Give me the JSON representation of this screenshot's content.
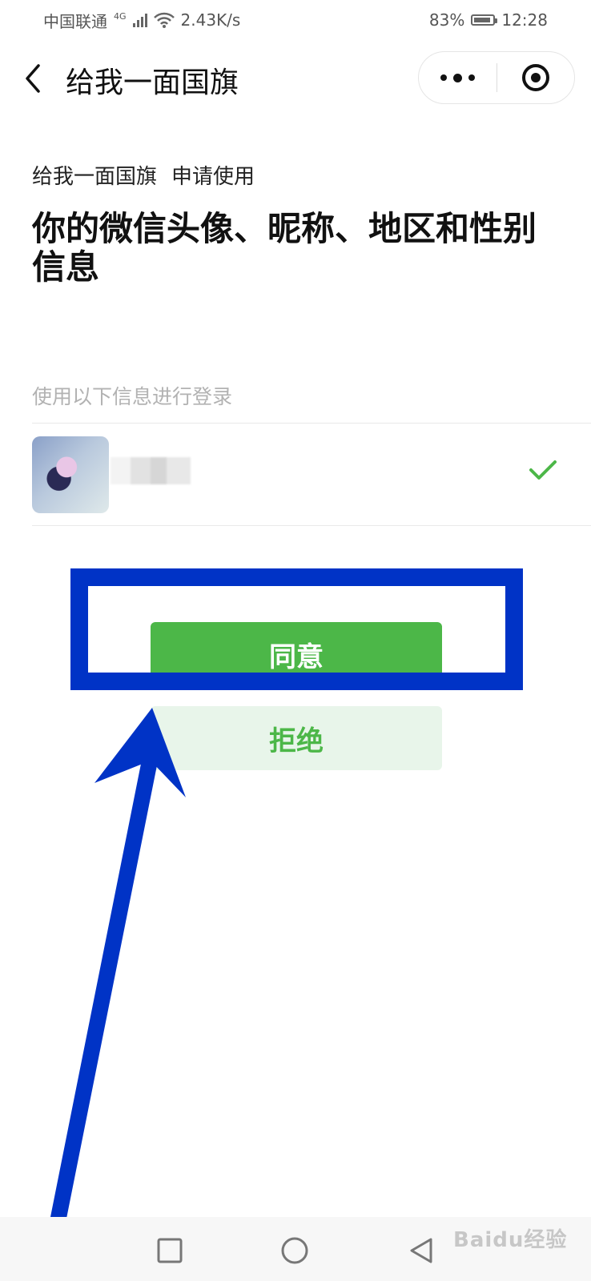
{
  "status_bar": {
    "carrier": "中国联通",
    "network": "4G",
    "speed": "2.43K/s",
    "battery": "83%",
    "time": "12:28"
  },
  "nav": {
    "title": "给我一面国旗",
    "back_icon": "chevron-left-icon",
    "more_icon": "more-dots-icon",
    "close_icon": "target-circle-icon"
  },
  "auth": {
    "app_name": "给我一面国旗",
    "request_label": "申请使用",
    "headline": "你的微信头像、昵称、地区和性别信息",
    "login_hint": "使用以下信息进行登录"
  },
  "account": {
    "selected_icon": "check-icon"
  },
  "buttons": {
    "agree": "同意",
    "reject": "拒绝"
  },
  "system_nav": {
    "recent_icon": "square-icon",
    "home_icon": "circle-icon",
    "back_icon": "triangle-back-icon"
  },
  "watermark": "Baidu经验",
  "colors": {
    "accent_green": "#4cb748",
    "reject_bg": "#e8f5ea",
    "annotation_blue": "#0033c6"
  }
}
